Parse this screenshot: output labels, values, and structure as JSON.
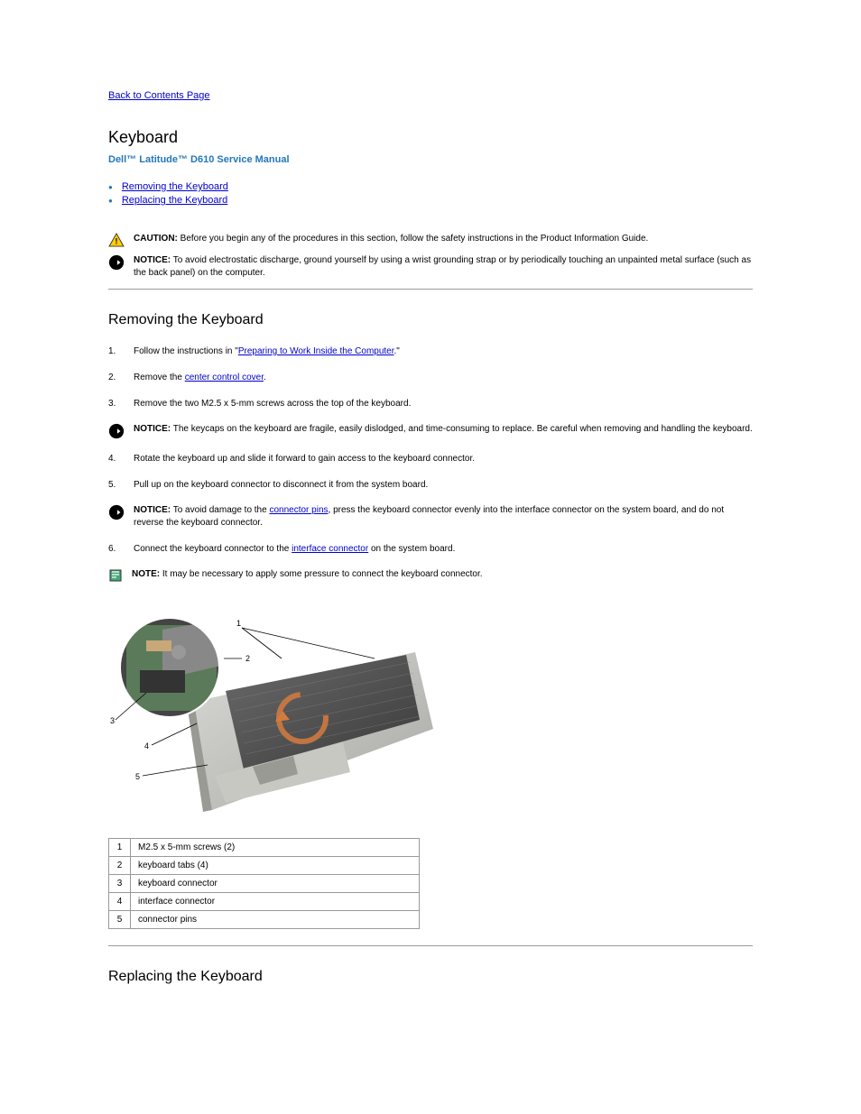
{
  "back_link": "Back to Contents Page",
  "page_title": "Keyboard",
  "subtitle": "Dell™ Latitude™ D610 Service Manual",
  "bullets": [
    "Removing the Keyboard",
    "Replacing the Keyboard"
  ],
  "caution": {
    "label": "CAUTION:",
    "text": "Before you begin any of the procedures in this section, follow the safety instructions in the Product Information Guide."
  },
  "notice_top": {
    "label": "NOTICE:",
    "text": "To avoid electrostatic discharge, ground yourself by using a wrist grounding strap or by periodically touching an unpainted metal surface (such as the back panel) on the computer."
  },
  "h2_remove": "Removing the Keyboard",
  "steps": [
    {
      "num": "1.",
      "text_before": "Follow the instructions in \"",
      "link": "Preparing to Work Inside the Computer",
      "text_after": ".\""
    },
    {
      "num": "2.",
      "text_before": "Remove the ",
      "link": "center control cover",
      "text_after": "."
    },
    {
      "num": "3.",
      "text_before": "Remove the two M2.5 x 5-mm screws across the top of the keyboard.",
      "link": null,
      "text_after": ""
    }
  ],
  "notice_mid": {
    "label": "NOTICE:",
    "text": "The keycaps on the keyboard are fragile, easily dislodged, and time-consuming to replace. Be careful when removing and handling the keyboard."
  },
  "step4": {
    "num": "4.",
    "text": "Rotate the keyboard up and slide it forward to gain access to the keyboard connector."
  },
  "step5": {
    "num": "5.",
    "text": "Pull up on the keyboard connector to disconnect it from the system board."
  },
  "notice_mid2": {
    "label": "NOTICE:",
    "text_before": "To avoid damage to the ",
    "link": "connector pins",
    "text_after": ", press the keyboard connector evenly into the interface connector on the system board, and do not reverse the keyboard connector."
  },
  "step6": {
    "num": "6.",
    "text_before": "Connect the keyboard connector to the ",
    "link": "interface connector",
    "text_after": " on the system board."
  },
  "note": {
    "label": "NOTE:",
    "text": "It may be necessary to apply some pressure to connect the keyboard connector."
  },
  "table": [
    {
      "n": "1",
      "label": "M2.5 x 5-mm screws (2)"
    },
    {
      "n": "2",
      "label": "keyboard tabs (4)"
    },
    {
      "n": "3",
      "label": "keyboard connector"
    },
    {
      "n": "4",
      "label": "interface connector"
    },
    {
      "n": "5",
      "label": "connector pins"
    }
  ],
  "h2_replace": "Replacing the Keyboard"
}
